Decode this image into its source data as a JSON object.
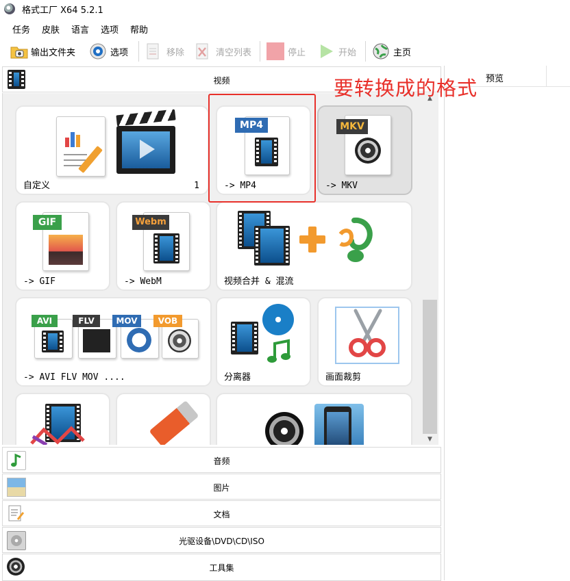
{
  "window": {
    "title": "格式工厂 X64 5.2.1"
  },
  "menu": [
    "任务",
    "皮肤",
    "语言",
    "选项",
    "帮助"
  ],
  "toolbar": {
    "output_folder": "输出文件夹",
    "options": "选项",
    "remove": "移除",
    "clear_list": "清空列表",
    "stop": "停止",
    "start": "开始",
    "home": "主页"
  },
  "categories": {
    "video": "视频",
    "audio": "音频",
    "image": "图片",
    "document": "文档",
    "disc": "光驱设备\\DVD\\CD\\ISO",
    "tools": "工具集"
  },
  "tiles": {
    "custom": {
      "label": "自定义",
      "count": "1"
    },
    "mp4": {
      "label": "-> MP4",
      "tag": "MP4"
    },
    "mkv": {
      "label": "-> MKV",
      "tag": "MKV"
    },
    "gif": {
      "label": "-> GIF",
      "tag": "GIF"
    },
    "webm": {
      "label": "-> WebM",
      "tag": "Webm"
    },
    "merge": {
      "label": "视频合并 & 混流"
    },
    "multi": {
      "label": "-> AVI FLV MOV ....",
      "tags": [
        "AVI",
        "FLV",
        "MOV",
        "VOB"
      ]
    },
    "splitter": {
      "label": "分离器"
    },
    "crop": {
      "label": "画面裁剪"
    }
  },
  "preview": {
    "header": "预览"
  },
  "annotation": {
    "text": "要转换成的格式"
  },
  "colors": {
    "annotation": "#e8302a",
    "mp4_tag": "#2f6cb3",
    "mkv_tag": "#3b3b3b",
    "gif_tag": "#3aa04a",
    "webm_tag": "#3b3b3b"
  }
}
